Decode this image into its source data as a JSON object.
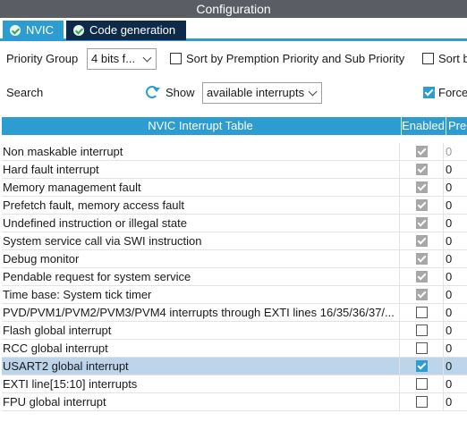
{
  "window": {
    "title": "Configuration"
  },
  "tabs": [
    {
      "label": "NVIC"
    },
    {
      "label": "Code generation"
    }
  ],
  "toolbar": {
    "priority_group_label": "Priority Group",
    "priority_group_value": "4 bits f...",
    "sort_premption_label": "Sort by Premption Priority and Sub Priority",
    "sort_b_label": "Sort b",
    "search_label": "Search",
    "show_label": "Show",
    "show_value": "available interrupts",
    "force_label": "Force",
    "force_checked": true
  },
  "table": {
    "headers": {
      "name": "NVIC Interrupt Table",
      "enabled": "Enabled",
      "preemption": "Pree"
    },
    "rows": [
      {
        "name": "Non maskable interrupt",
        "enabled": true,
        "locked": true,
        "priority": "0"
      },
      {
        "name": "Hard fault interrupt",
        "enabled": true,
        "locked": true,
        "priority": "0"
      },
      {
        "name": "Memory management fault",
        "enabled": true,
        "locked": true,
        "priority": "0"
      },
      {
        "name": "Prefetch fault, memory access fault",
        "enabled": true,
        "locked": true,
        "priority": "0"
      },
      {
        "name": "Undefined instruction or illegal state",
        "enabled": true,
        "locked": true,
        "priority": "0"
      },
      {
        "name": "System service call via SWI instruction",
        "enabled": true,
        "locked": true,
        "priority": "0"
      },
      {
        "name": "Debug monitor",
        "enabled": true,
        "locked": true,
        "priority": "0"
      },
      {
        "name": "Pendable request for system service",
        "enabled": true,
        "locked": true,
        "priority": "0"
      },
      {
        "name": "Time base: System tick timer",
        "enabled": true,
        "locked": true,
        "priority": "0"
      },
      {
        "name": "PVD/PVM1/PVM2/PVM3/PVM4 interrupts through EXTI lines 16/35/36/37/...",
        "enabled": false,
        "locked": false,
        "priority": "0"
      },
      {
        "name": "Flash global interrupt",
        "enabled": false,
        "locked": false,
        "priority": "0"
      },
      {
        "name": "RCC global interrupt",
        "enabled": false,
        "locked": false,
        "priority": "0"
      },
      {
        "name": "USART2 global interrupt",
        "enabled": true,
        "locked": false,
        "selected": true,
        "priority": "0"
      },
      {
        "name": "EXTI line[15:10] interrupts",
        "enabled": false,
        "locked": false,
        "priority": "0"
      },
      {
        "name": "FPU global interrupt",
        "enabled": false,
        "locked": false,
        "priority": "0"
      }
    ]
  }
}
